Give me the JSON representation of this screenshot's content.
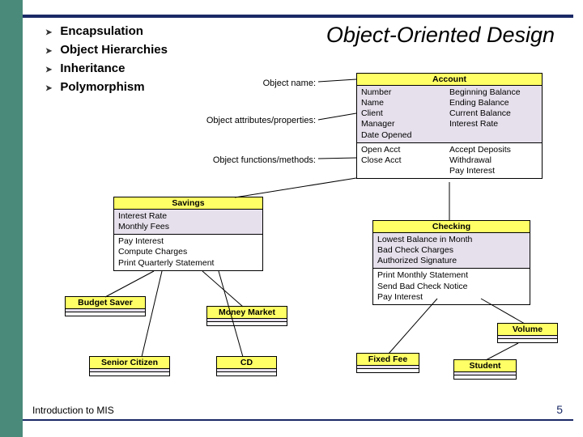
{
  "title": "Object-Oriented Design",
  "bullets": [
    "Encapsulation",
    "Object Hierarchies",
    "Inheritance",
    "Polymorphism"
  ],
  "labels": {
    "objectName": "Object name:",
    "objectAttrs": "Object attributes/properties:",
    "objectMethods": "Object functions/methods:"
  },
  "account": {
    "name": "Account",
    "attrs_left": "Number\nName\nClient\nManager\nDate Opened",
    "attrs_right": "Beginning Balance\nEnding Balance\nCurrent Balance\nInterest Rate",
    "methods_left": "Open Acct\nClose Acct",
    "methods_right": "Accept Deposits\nWithdrawal\nPay Interest"
  },
  "savings": {
    "name": "Savings",
    "attrs": "Interest Rate\nMonthly Fees",
    "methods": "Pay Interest\nCompute Charges\nPrint Quarterly Statement"
  },
  "checking": {
    "name": "Checking",
    "attrs": "Lowest Balance in Month\nBad Check Charges\nAuthorized Signature",
    "methods": "Print Monthly Statement\nSend Bad Check Notice\nPay Interest"
  },
  "budgetSaver": {
    "name": "Budget Saver"
  },
  "moneyMarket": {
    "name": "Money Market"
  },
  "seniorCitizen": {
    "name": "Senior Citizen"
  },
  "cd": {
    "name": "CD"
  },
  "volume": {
    "name": "Volume"
  },
  "fixedFee": {
    "name": "Fixed Fee"
  },
  "student": {
    "name": "Student"
  },
  "footer": {
    "left": "Introduction to MIS",
    "right": "5"
  }
}
